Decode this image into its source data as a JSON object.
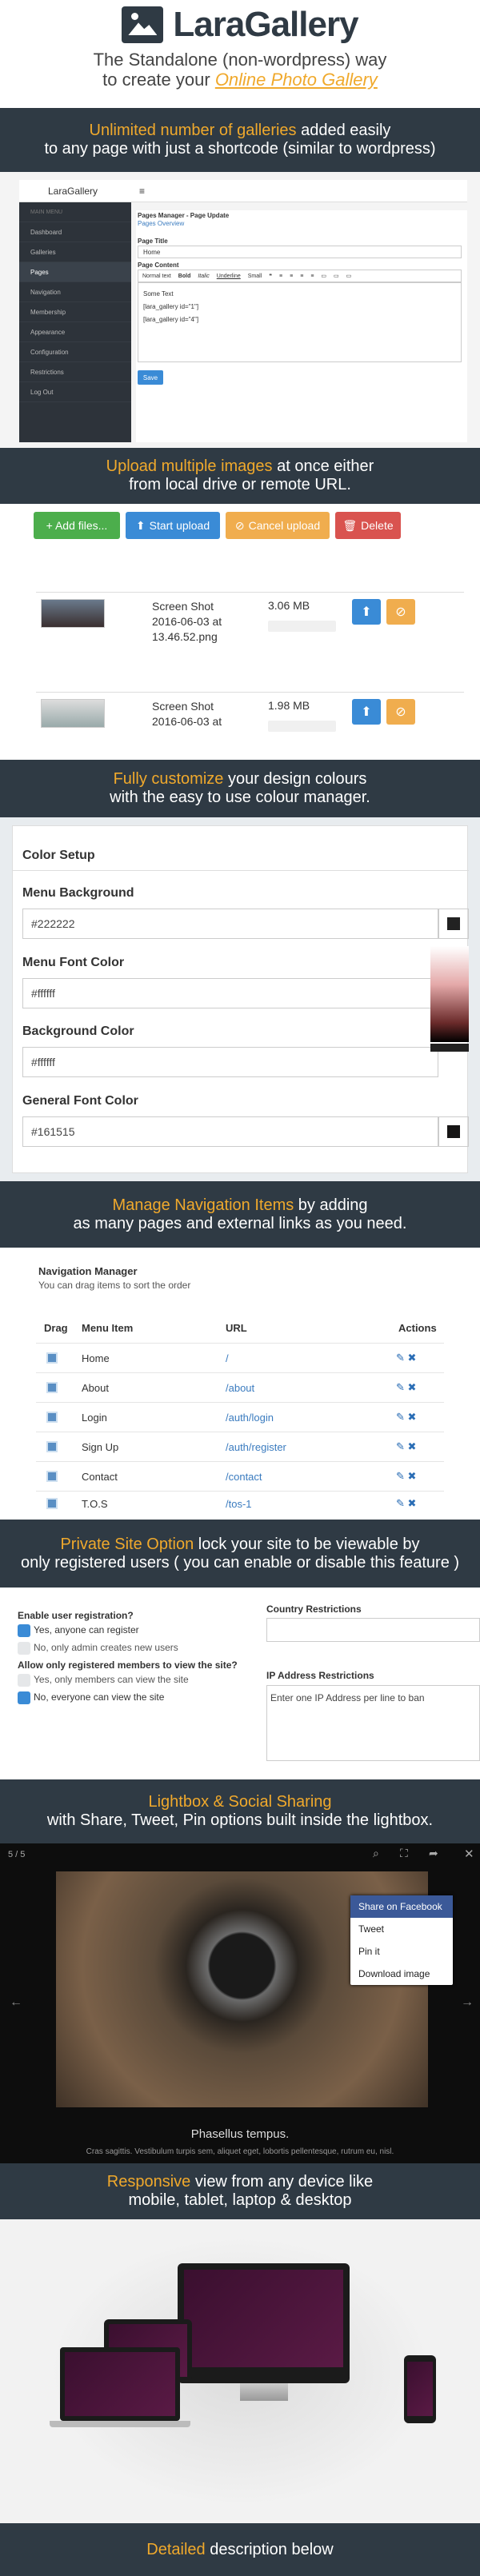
{
  "header": {
    "title": "LaraGallery",
    "tagline_1": "The Standalone (non-wordpress) way",
    "tagline_2": "to create your ",
    "tagline_link": "Online Photo Gallery"
  },
  "band1": {
    "hl": "Unlimited number of galleries",
    "text_1": " added easily",
    "line_2": "to any page with just a shortcode (similar to wordpress)"
  },
  "admin": {
    "brand": "LaraGallery",
    "menu_icon": "≡",
    "section": "MAIN MENU",
    "items": [
      "Dashboard",
      "Galleries",
      "Pages",
      "Navigation",
      "Membership",
      "Appearance",
      "Configuration",
      "Restrictions",
      "Log Out"
    ],
    "page_heading": "Pages Manager - Page Update",
    "breadcrumb": "Pages Overview",
    "title_label": "Page Title",
    "title_value": "Home",
    "content_label": "Page Content",
    "toolbar": [
      "Normal text",
      "Bold",
      "Italic",
      "Underline",
      "Small",
      "❝",
      "≡",
      "≡",
      "≡",
      "≡",
      "▭",
      "▭",
      "▭"
    ],
    "content_lines": [
      "Some Text",
      "[lara_gallery id=\"1\"]",
      "[lara_gallery id=\"4\"]"
    ],
    "save": "Save"
  },
  "band2": {
    "hl": "Upload multiple images",
    "text_1": " at once either",
    "line_2": "from local drive or remote URL."
  },
  "upload": {
    "add": "+ Add files...",
    "start": "Start upload",
    "cancel": "Cancel upload",
    "delete": "Delete",
    "files": [
      {
        "name": "Screen Shot 2016-06-03 at 13.46.52.png",
        "size": "3.06 MB"
      },
      {
        "name": "Screen Shot 2016-06-03 at",
        "size": "1.98 MB"
      }
    ]
  },
  "band3": {
    "hl": "Fully customize",
    "text_1": " your design colours",
    "line_2": "with the easy to use colour manager."
  },
  "colors": {
    "heading": "Color Setup",
    "fields": [
      {
        "label": "Menu Background",
        "value": "#222222",
        "swatch": "#222222"
      },
      {
        "label": "Menu Font Color",
        "value": "#ffffff",
        "swatch": "#ffffff"
      },
      {
        "label": "Background Color",
        "value": "#ffffff",
        "swatch": "#ffffff"
      },
      {
        "label": "General Font Color",
        "value": "#161515",
        "swatch": "#161515"
      }
    ]
  },
  "band4": {
    "hl": "Manage Navigation Items",
    "text_1": " by adding",
    "line_2": "as many pages and external links as you need."
  },
  "nav": {
    "heading": "Navigation Manager",
    "hint": "You can drag items to sort the order",
    "cols": [
      "Drag",
      "Menu Item",
      "URL",
      "Actions"
    ],
    "rows": [
      {
        "item": "Home",
        "url": "/"
      },
      {
        "item": "About",
        "url": "/about"
      },
      {
        "item": "Login",
        "url": "/auth/login"
      },
      {
        "item": "Sign Up",
        "url": "/auth/register"
      },
      {
        "item": "Contact",
        "url": "/contact"
      },
      {
        "item": "T.O.S",
        "url": "/tos-1"
      }
    ],
    "actions": "✎ ✖"
  },
  "band5": {
    "hl": "Private Site Option",
    "text_1": " lock your site to be viewable by",
    "line_2": "only registered users ( you can enable or disable this feature )"
  },
  "priv": {
    "q1": "Enable user registration?",
    "q1a": "Yes, anyone can register",
    "q1b": "No, only admin creates new users",
    "q2": "Allow only registered members to view the site?",
    "q2a": "Yes, only members can view the site",
    "q2b": "No, everyone can view the site",
    "country": "Country Restrictions",
    "ip": "IP Address Restrictions",
    "ip_ph": "Enter one IP Address per line to ban"
  },
  "band6": {
    "hl": "Lightbox & Social Sharing",
    "line_2": "with Share, Tweet, Pin options built inside the lightbox."
  },
  "lightbox": {
    "counter": "5 / 5",
    "share": [
      "Share on Facebook",
      "Tweet",
      "Pin it",
      "Download image"
    ],
    "caption": "Phasellus tempus.",
    "sub": "Cras sagittis. Vestibulum turpis sem, aliquet eget, lobortis pellentesque, rutrum eu, nisl.",
    "prev": "←",
    "next": "→",
    "close": "✕"
  },
  "band7": {
    "hl": "Responsive",
    "text_1": " view from any device like",
    "line_2": "mobile, tablet, laptop & desktop"
  },
  "band8": {
    "hl": "Detailed",
    "text_1": " description below"
  }
}
